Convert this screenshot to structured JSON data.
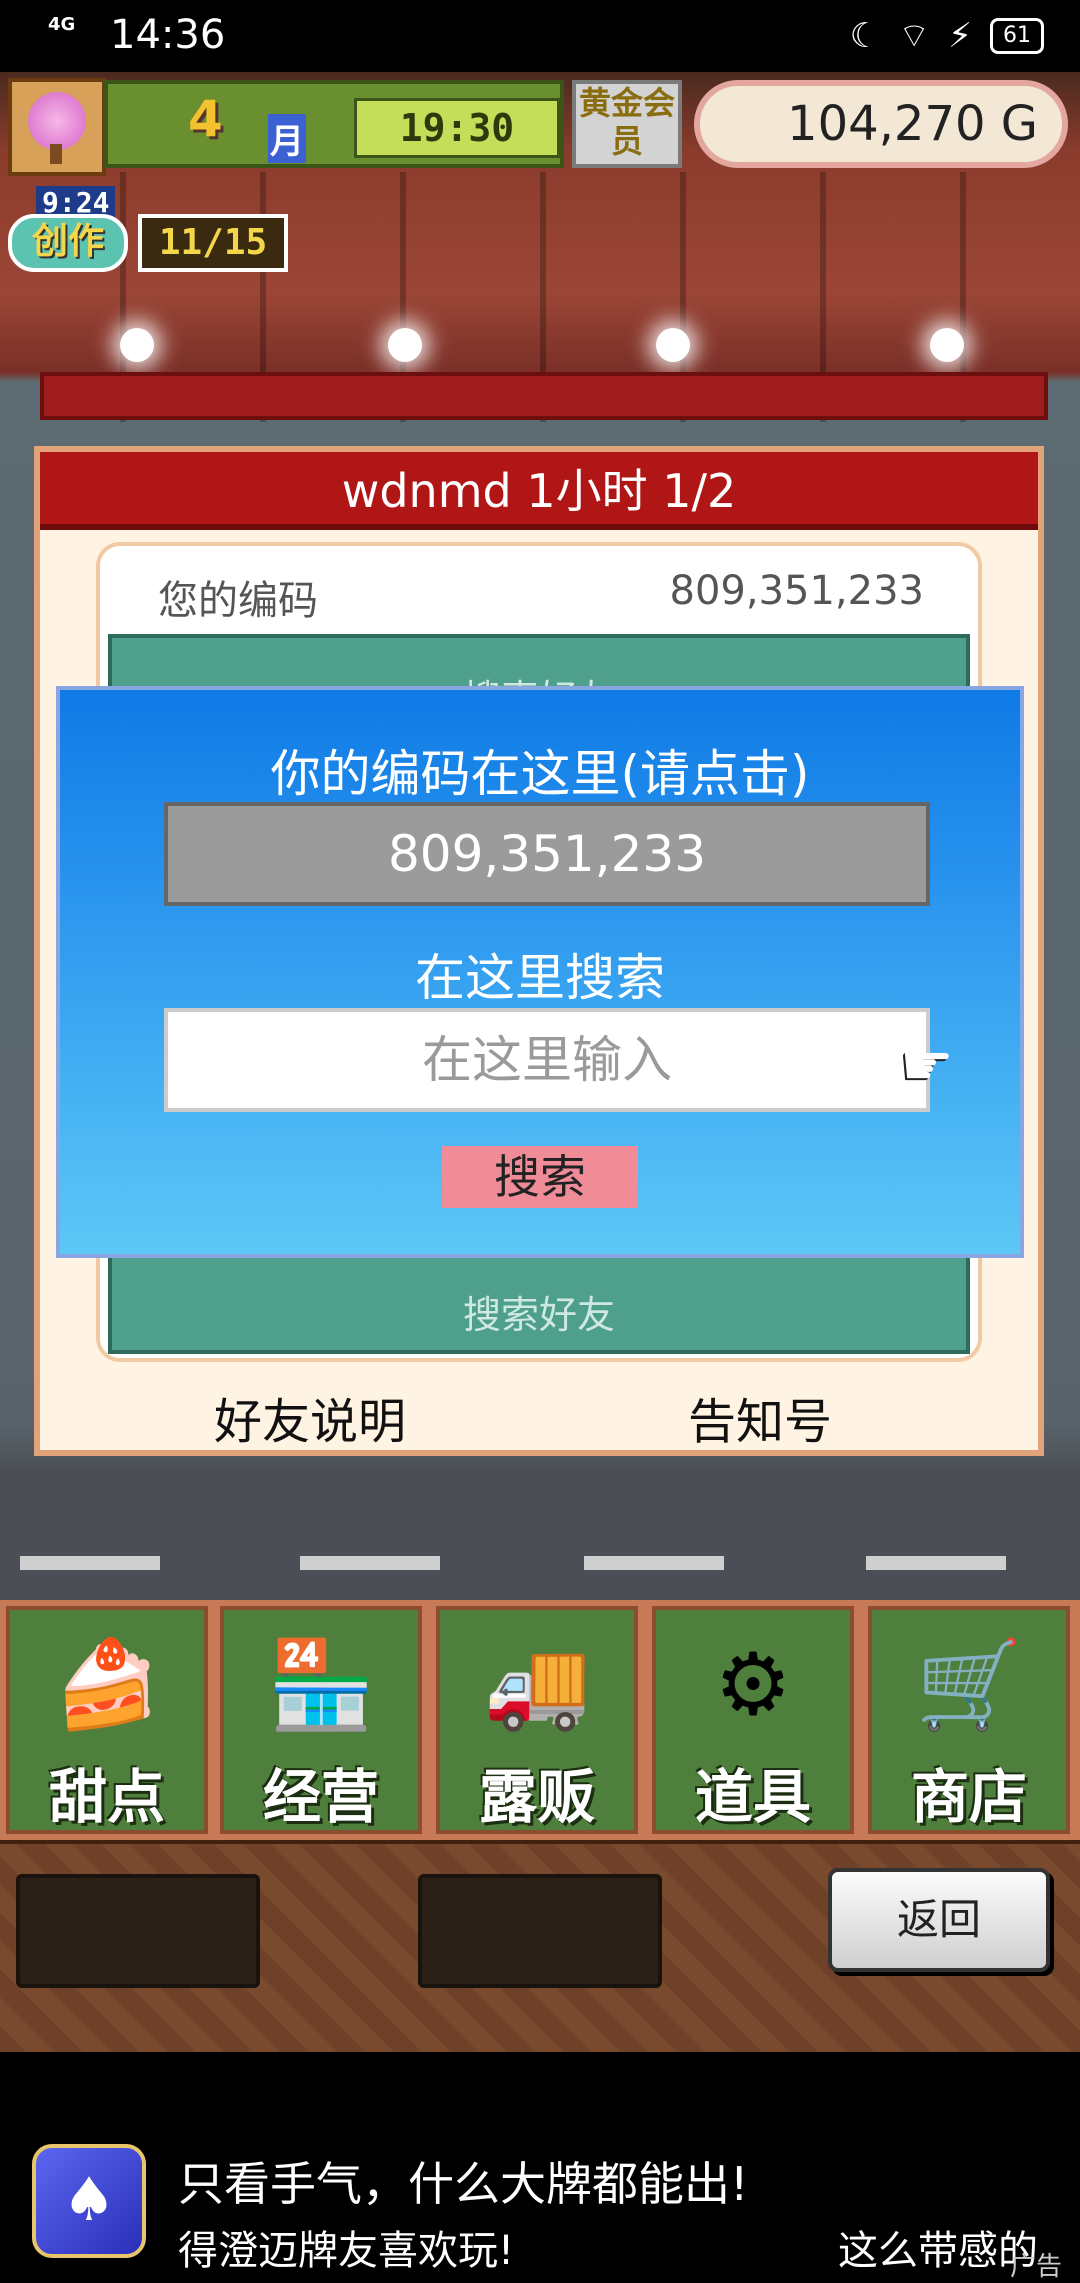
{
  "status_bar": {
    "network": "4G",
    "time": "14:36",
    "battery": "61"
  },
  "hud": {
    "month": "4",
    "month_unit": "月",
    "clock": "19:30",
    "member": "黄金会员",
    "money": "104,270 G",
    "create_time": "9:24",
    "create_label": "创作",
    "create_progress": "11/15"
  },
  "panel": {
    "header": "wdnmd  1小时 1/2",
    "your_code_label": "您的编码",
    "your_code_value": "809,351,233",
    "search_friends_top": "搜索好友",
    "search_friends_bottom": "搜索好友",
    "friend_help": "好友说明",
    "notice": "告知号"
  },
  "dialog": {
    "title": "你的编码在这里(请点击)",
    "code": "809,351,233",
    "search_label": "在这里搜索",
    "input_placeholder": "在这里输入",
    "search_button": "搜索"
  },
  "menu": {
    "items": [
      {
        "label": "甜点",
        "icon": "cake-icon",
        "glyph": "🍰"
      },
      {
        "label": "经营",
        "icon": "shop-icon",
        "glyph": "🏪"
      },
      {
        "label": "露贩",
        "icon": "food-truck-icon",
        "glyph": "🚚"
      },
      {
        "label": "道具",
        "icon": "items-icon",
        "glyph": "⚙"
      },
      {
        "label": "商店",
        "icon": "cart-icon",
        "glyph": "🛒"
      }
    ],
    "back": "返回"
  },
  "ad": {
    "line1": "只看手气，什么大牌都能出!",
    "line2": "得澄迈牌友喜欢玩!",
    "line3": "这么带感的",
    "tag": "广告"
  }
}
